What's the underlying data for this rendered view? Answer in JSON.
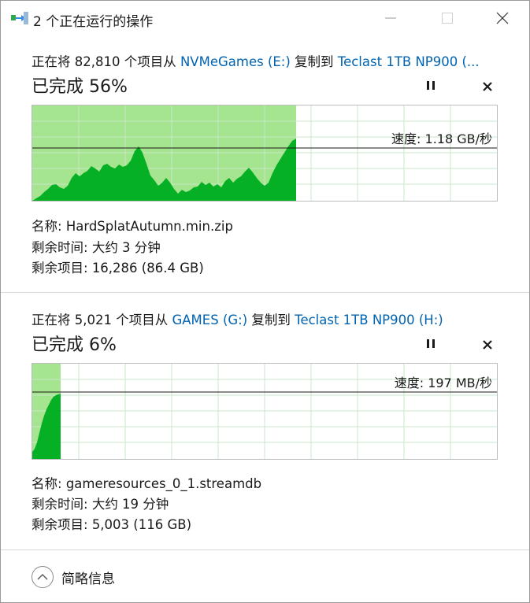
{
  "window": {
    "title": "2 个正在运行的操作"
  },
  "operations": [
    {
      "prefix": "正在将 82,810 个项目从 ",
      "source": "NVMeGames (E:)",
      "middle": " 复制到 ",
      "destination": "Teclast 1TB NP900 (...",
      "percent_text": "已完成 56%",
      "progress": 0.56,
      "speed_text": "速度: 1.18 GB/秒",
      "name_label": "名称:",
      "name_value": "HardSplatAutumn.min.zip",
      "time_label": "剩余时间:",
      "time_value": "大约 3 分钟",
      "items_label": "剩余项目:",
      "items_value": "16,286 (86.4 GB)"
    },
    {
      "prefix": "正在将 5,021 个项目从 ",
      "source": "GAMES (G:)",
      "middle": " 复制到 ",
      "destination": "Teclast 1TB NP900 (H:)",
      "percent_text": "已完成 6%",
      "progress": 0.06,
      "speed_text": "速度: 197 MB/秒",
      "name_label": "名称:",
      "name_value": "gameresources_0_1.streamdb",
      "time_label": "剩余时间:",
      "time_value": "大约 19 分钟",
      "items_label": "剩余项目:",
      "items_value": "5,003 (116 GB)"
    }
  ],
  "footer": {
    "details_label": "简略信息"
  },
  "colors": {
    "accent_link": "#0063b1",
    "progress_fill": "#a6e58f",
    "speed_fill": "#06b025",
    "grid_line": "#c8e8c8"
  },
  "icons": {
    "app": "copy-progress-icon",
    "minimize": "minimize-icon",
    "maximize": "maximize-icon",
    "close": "close-icon",
    "pause": "pause-icon",
    "cancel": "cancel-icon",
    "collapse": "chevron-up-icon"
  }
}
